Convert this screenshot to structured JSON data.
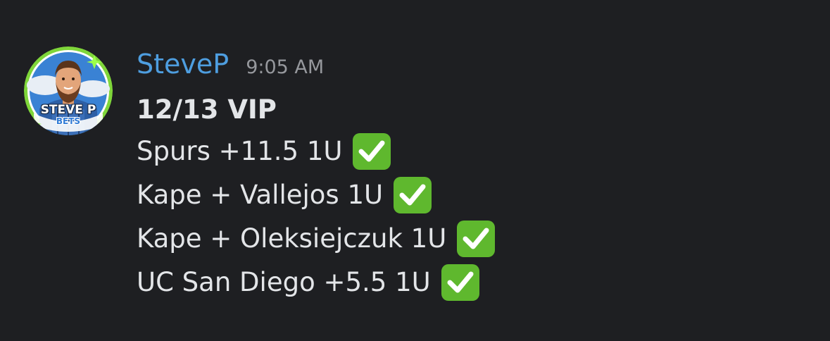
{
  "message": {
    "avatar": {
      "line1": "STEVE P",
      "line2": "BETS",
      "ring_color": "#7fd63a"
    },
    "username": "SteveP",
    "username_color": "#4e9ee0",
    "timestamp": "9:05 AM",
    "lines": [
      {
        "text": "12/13 VIP",
        "bold": true
      },
      {
        "text": "Spurs +11.5 1U",
        "icon": "check-mark-button-icon"
      },
      {
        "text": "Kape + Vallejos 1U",
        "icon": "check-mark-button-icon"
      },
      {
        "text": "Kape + Oleksiejczuk 1U",
        "icon": "check-mark-button-icon"
      },
      {
        "text": "UC San Diego +5.5 1U",
        "icon": "check-mark-button-icon"
      }
    ],
    "check_color": "#5fb82e"
  }
}
